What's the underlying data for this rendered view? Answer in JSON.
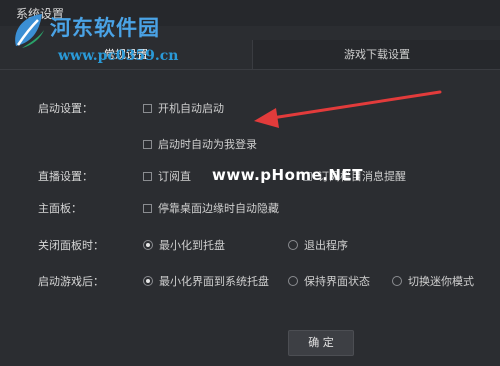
{
  "window": {
    "title": "系统设置"
  },
  "tabs": [
    {
      "label": "常规设置",
      "active": true
    },
    {
      "label": "游戏下载设置",
      "active": false
    }
  ],
  "sections": {
    "startup": {
      "label": "启动设置：",
      "options": [
        {
          "label": "开机自动启动",
          "checked": false
        },
        {
          "label": "启动时自动为我登录",
          "checked": false
        }
      ]
    },
    "live": {
      "label": "直播设置：",
      "options": [
        {
          "label": "订阅直",
          "checked": false
        },
        {
          "label": "订阅栏目消息提醒",
          "checked": false
        }
      ]
    },
    "panel": {
      "label": "主面板：",
      "options": [
        {
          "label": "停靠桌面边缘时自动隐藏",
          "checked": false
        }
      ]
    },
    "close_panel": {
      "label": "关闭面板时：",
      "options": [
        {
          "label": "最小化到托盘",
          "selected": true
        },
        {
          "label": "退出程序",
          "selected": false
        }
      ]
    },
    "after_game": {
      "label": "启动游戏后：",
      "options": [
        {
          "label": "最小化界面到系统托盘",
          "selected": true
        },
        {
          "label": "保持界面状态",
          "selected": false
        },
        {
          "label": "切换迷你模式",
          "selected": false
        }
      ]
    }
  },
  "buttons": {
    "ok": "确 定"
  },
  "watermarks": {
    "logo_text": "河东软件园",
    "logo_url": "www.pc0359.cn",
    "overlay": "www.pHome.NET"
  },
  "colors": {
    "annotation_arrow": "#e23b3b",
    "logo_blue": "#4aa3e6"
  }
}
